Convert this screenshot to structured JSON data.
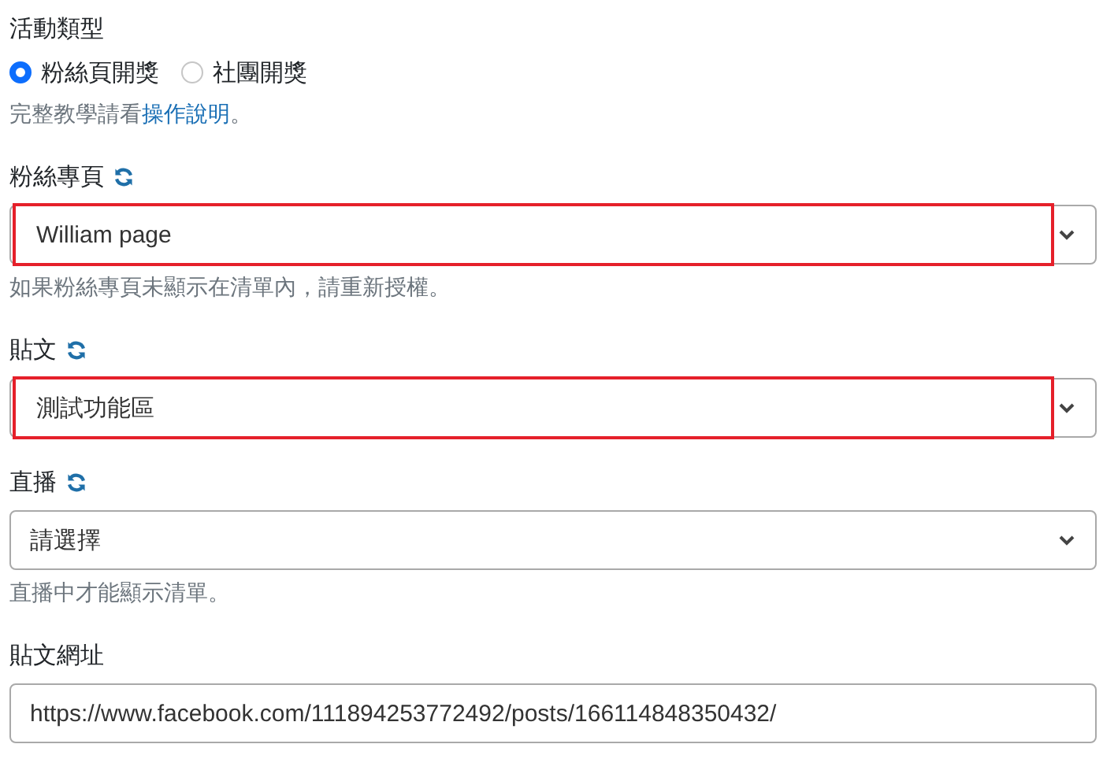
{
  "activity_type": {
    "label": "活動類型",
    "options": [
      {
        "label": "粉絲頁開獎",
        "selected": true
      },
      {
        "label": "社團開獎",
        "selected": false
      }
    ],
    "help": {
      "before": "完整教學請看",
      "link": "操作說明",
      "after": "。"
    }
  },
  "fields": [
    {
      "kind": "select",
      "label": "粉絲專頁",
      "refresh": true,
      "value": "William page",
      "highlighted": true,
      "help": "如果粉絲專頁未顯示在清單內，請重新授權。"
    },
    {
      "kind": "select",
      "label": "貼文",
      "refresh": true,
      "value": "測試功能區",
      "highlighted": true
    },
    {
      "kind": "select",
      "label": "直播",
      "refresh": true,
      "value": "請選擇",
      "highlighted": false,
      "help": "直播中才能顯示清單。"
    },
    {
      "kind": "text",
      "label": "貼文網址",
      "refresh": false,
      "value": "https://www.facebook.com/111894253772492/posts/166114848350432/",
      "highlighted": false
    }
  ]
}
